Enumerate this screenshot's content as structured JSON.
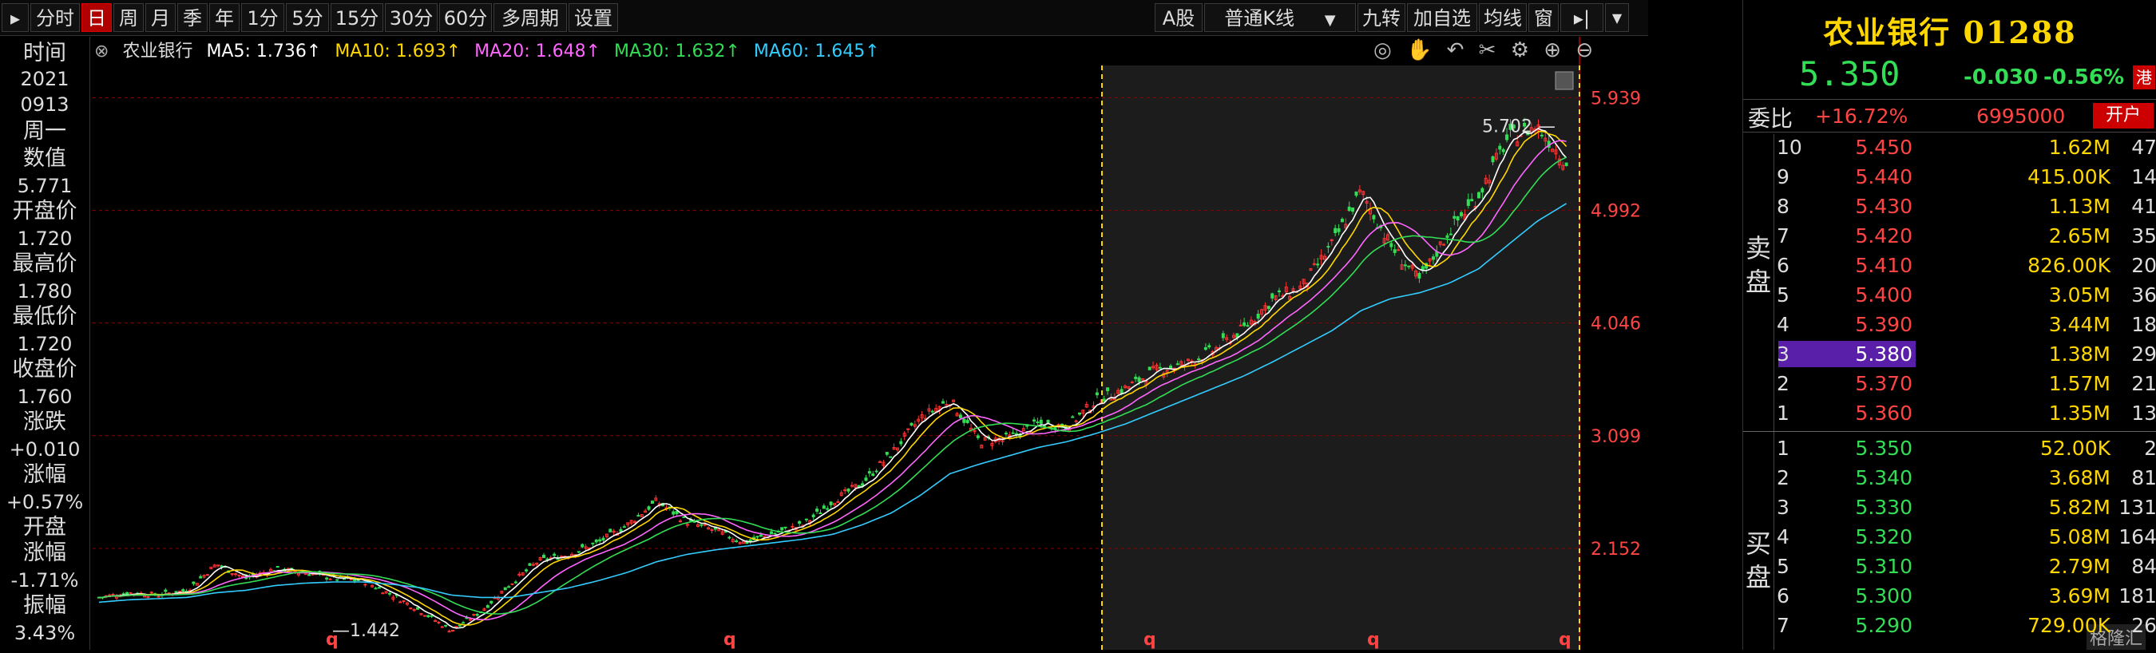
{
  "toolbar": {
    "left_items": [
      "分时",
      "日",
      "周",
      "月",
      "季",
      "年",
      "1分",
      "5分",
      "15分",
      "30分",
      "60分",
      "多周期",
      "设置"
    ],
    "selected": "日",
    "market": "A股",
    "kline_type": "普通K线",
    "right_items": [
      "九转",
      "加自选",
      "均线",
      "窗"
    ]
  },
  "info": {
    "time_label": "时间",
    "year": "2021",
    "date": "0913",
    "weekday": "周一",
    "value_label": "数值",
    "value": "5.771",
    "open_label": "开盘价",
    "open": "1.720",
    "high_label": "最高价",
    "high": "1.780",
    "low_label": "最低价",
    "low": "1.720",
    "close_label": "收盘价",
    "close": "1.760",
    "change_label": "涨跌",
    "change": "+0.010",
    "pct_label": "涨幅",
    "pct": "+0.57%",
    "open_pct_label1": "开盘",
    "open_pct_label2": "涨幅",
    "open_pct": "-1.71%",
    "amp_label": "振幅",
    "amp": "3.43%"
  },
  "legend": {
    "stock": "农业银行",
    "ma5": "MA5: 1.736↑",
    "ma10": "MA10: 1.693↑",
    "ma20": "MA20: 1.648↑",
    "ma30": "MA30: 1.632↑",
    "ma60": "MA60: 1.645↑"
  },
  "colors": {
    "ma5": "#ffffff",
    "ma10": "#ffd700",
    "ma20": "#ff66ff",
    "ma30": "#33dd55",
    "ma60": "#33ccff",
    "up": "#ff3333",
    "down": "#33dd55",
    "grid": "#8b0000"
  },
  "chart_data": {
    "type": "line",
    "y_ticks": [
      "5.939",
      "4.992",
      "4.046",
      "3.099",
      "2.152"
    ],
    "annotations": {
      "max": "5.702",
      "min": "1.442"
    },
    "close_approx": [
      1.74,
      1.78,
      1.76,
      1.8,
      2.02,
      1.9,
      1.98,
      1.95,
      1.9,
      1.88,
      1.76,
      1.62,
      1.46,
      1.62,
      1.85,
      2.05,
      2.1,
      2.2,
      2.35,
      2.55,
      2.38,
      2.3,
      2.2,
      2.28,
      2.35,
      2.55,
      2.7,
      2.95,
      3.25,
      3.4,
      3.05,
      3.08,
      3.2,
      3.18,
      3.4,
      3.5,
      3.65,
      3.7,
      3.82,
      4.0,
      4.25,
      4.35,
      4.7,
      5.15,
      4.7,
      4.4,
      4.82,
      5.12,
      5.6,
      5.7,
      5.4
    ],
    "ma60_approx": [
      1.7,
      1.72,
      1.73,
      1.74,
      1.78,
      1.8,
      1.84,
      1.86,
      1.87,
      1.87,
      1.85,
      1.82,
      1.76,
      1.74,
      1.74,
      1.78,
      1.82,
      1.88,
      1.95,
      2.04,
      2.1,
      2.14,
      2.17,
      2.2,
      2.23,
      2.27,
      2.35,
      2.45,
      2.6,
      2.78,
      2.86,
      2.93,
      3.0,
      3.05,
      3.12,
      3.2,
      3.3,
      3.4,
      3.5,
      3.6,
      3.72,
      3.85,
      3.98,
      4.15,
      4.25,
      4.3,
      4.38,
      4.5,
      4.7,
      4.9,
      5.05
    ]
  },
  "right": {
    "name": "农业银行 01288",
    "last": "5.350",
    "chg": "-0.030",
    "chgpct": "-0.56%",
    "badge": "港",
    "wb_label": "委比",
    "wb": "+16.72%",
    "wb_vol": "6995000",
    "wb_btn": "开户",
    "sell_label": "卖盘",
    "buy_label": "买盘",
    "asks": [
      {
        "lvl": "10",
        "px": "5.450",
        "vol": "1.62M",
        "cnt": "47"
      },
      {
        "lvl": "9",
        "px": "5.440",
        "vol": "415.00K",
        "cnt": "14"
      },
      {
        "lvl": "8",
        "px": "5.430",
        "vol": "1.13M",
        "cnt": "41"
      },
      {
        "lvl": "7",
        "px": "5.420",
        "vol": "2.65M",
        "cnt": "35"
      },
      {
        "lvl": "6",
        "px": "5.410",
        "vol": "826.00K",
        "cnt": "20"
      },
      {
        "lvl": "5",
        "px": "5.400",
        "vol": "3.05M",
        "cnt": "36"
      },
      {
        "lvl": "4",
        "px": "5.390",
        "vol": "3.44M",
        "cnt": "18"
      },
      {
        "lvl": "3",
        "px": "5.380",
        "vol": "1.38M",
        "cnt": "29"
      },
      {
        "lvl": "2",
        "px": "5.370",
        "vol": "1.57M",
        "cnt": "21"
      },
      {
        "lvl": "1",
        "px": "5.360",
        "vol": "1.35M",
        "cnt": "13"
      }
    ],
    "bids": [
      {
        "lvl": "1",
        "px": "5.350",
        "vol": "52.00K",
        "cnt": "2"
      },
      {
        "lvl": "2",
        "px": "5.340",
        "vol": "3.68M",
        "cnt": "81"
      },
      {
        "lvl": "3",
        "px": "5.330",
        "vol": "5.82M",
        "cnt": "131"
      },
      {
        "lvl": "4",
        "px": "5.320",
        "vol": "5.08M",
        "cnt": "164"
      },
      {
        "lvl": "5",
        "px": "5.310",
        "vol": "2.79M",
        "cnt": "84"
      },
      {
        "lvl": "6",
        "px": "5.300",
        "vol": "3.69M",
        "cnt": "181"
      },
      {
        "lvl": "7",
        "px": "5.290",
        "vol": "729.00K",
        "cnt": "26"
      }
    ],
    "watermark": "格隆汇"
  }
}
